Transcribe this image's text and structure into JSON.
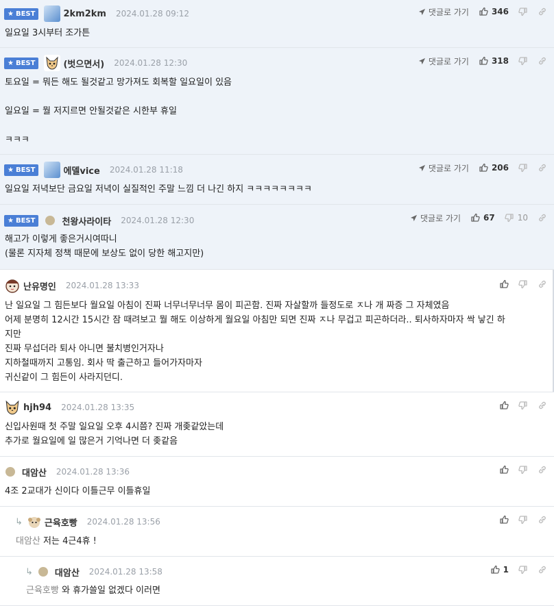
{
  "best_label": "BEST",
  "reply_link_label": "댓글로 가기",
  "comments": [
    {
      "nick": "2km2km",
      "date": "2024.01.28 09:12",
      "body": "일요일 3시부터 조가튼",
      "up": "346"
    },
    {
      "nick": "(벗으면서)",
      "date": "2024.01.28 12:30",
      "body": "토요일 = 뭐든 해도 될것같고 망가져도 회복할 일요일이 있음\n\n일요일 = 뭘 저지르면 안될것같은 시한부 휴일\n\nㅋㅋㅋ",
      "up": "318"
    },
    {
      "nick": "에델vice",
      "date": "2024.01.28 11:18",
      "body": "일요일 저녁보단 금요일 저녁이 실질적인 주말 느낌 더 나긴 하지 ㅋㅋㅋㅋㅋㅋㅋㅋ",
      "up": "206"
    },
    {
      "nick": "천왕사라이타",
      "date": "2024.01.28 12:30",
      "body": "해고가 이렇게 좋은거시여따니\n(물론 지자체 정책 때문에 보상도 없이 당한 해고지만)",
      "up": "67",
      "down": "10"
    },
    {
      "nick": "난유명인",
      "date": "2024.01.28 13:33",
      "body": "난 일요일 그 힘든보다 월요일 아침이 진짜 너무너무너무 몸이 피곤함. 진짜 자살할까 들정도로 ㅈ나 개 짜증 그 자체였음\n어제 분명히 12시간 15시간 잠 때려보고 뭘 해도 이상하게 월요일 아침만 되면 진짜 ㅈ나 무겁고 피곤하더라.. 퇴사하자마자 싹 낳긴 하\n지만\n진짜 무섭더라 퇴사 아니면 불치병인거자나\n지하철때까지 고통임. 회사 딱 출근하고 들어가자마자\n귀신같이 그 힘든이 사라지던디."
    },
    {
      "nick": "hjh94",
      "date": "2024.01.28 13:35",
      "body": "신입사원때 첫 주말 일요일 오후 4시쯤? 진짜 개좆같았는데\n추가로 월요일에 일 많은거 기억나면 더 좆같음"
    },
    {
      "nick": "대암산",
      "date": "2024.01.28 13:36",
      "body": "4조 2교대가 신이다 이틀근무 이틀휴일"
    },
    {
      "nick": "근육호빵",
      "date": "2024.01.28 13:56",
      "mention": "대암산",
      "body": "저는 4근4휴 !"
    },
    {
      "nick": "대암산",
      "date": "2024.01.28 13:58",
      "mention": "근육호빵",
      "body": "와 휴가쓸일 없겠다 이러면",
      "up": "1"
    }
  ],
  "colors": {
    "best_bg": "#eef3f9",
    "badge": "#4a7fd6",
    "date": "#9aa0a8"
  }
}
